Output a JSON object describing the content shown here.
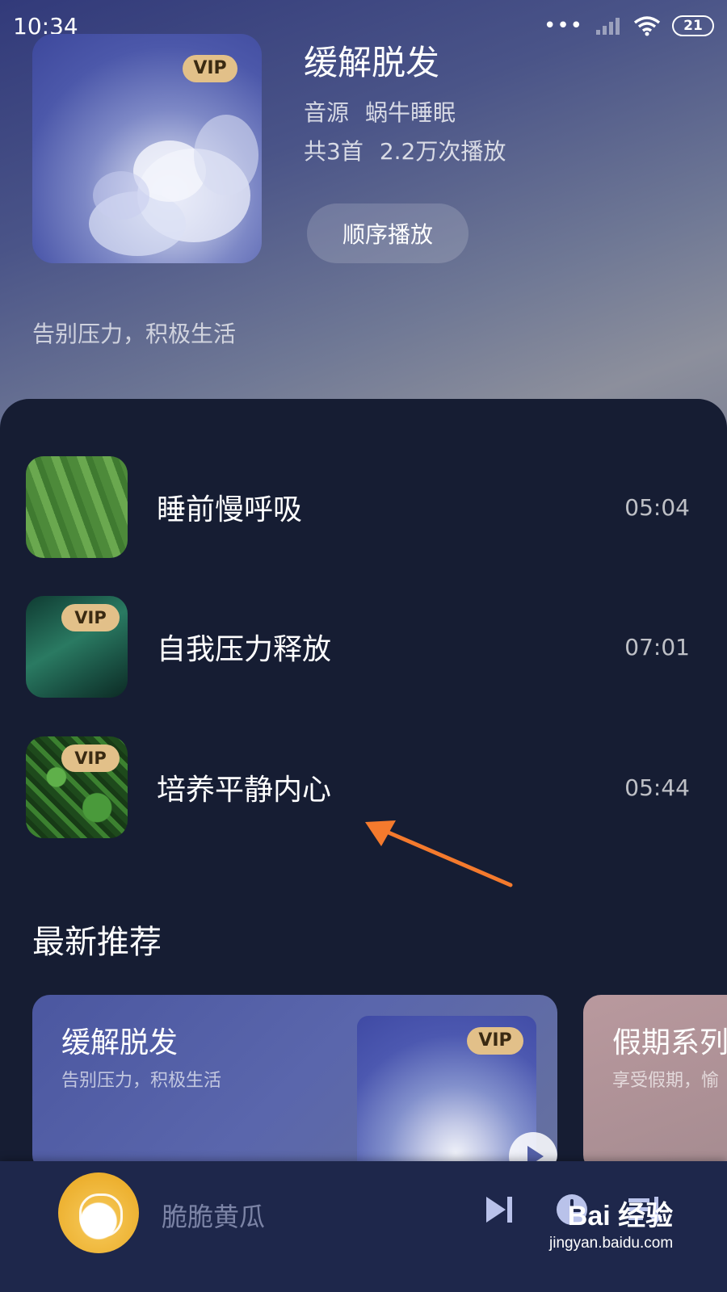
{
  "status_bar": {
    "time": "10:34",
    "battery": "21"
  },
  "album": {
    "title": "缓解脱发",
    "source_label": "音源",
    "source_name": "蜗牛睡眠",
    "track_count": "共3首",
    "play_count": "2.2万次播放",
    "play_order_button": "顺序播放",
    "description": "告别压力，积极生活",
    "vip": "VIP"
  },
  "tracks": [
    {
      "title": "睡前慢呼吸",
      "duration": "05:04",
      "vip": ""
    },
    {
      "title": "自我压力释放",
      "duration": "07:01",
      "vip": "VIP"
    },
    {
      "title": "培养平静内心",
      "duration": "05:44",
      "vip": "VIP"
    }
  ],
  "recommend": {
    "section_title": "最新推荐",
    "cards": [
      {
        "title": "缓解脱发",
        "subtitle": "告别压力，积极生活",
        "vip": "VIP"
      },
      {
        "title": "假期系列",
        "subtitle": "享受假期，愉"
      }
    ]
  },
  "player": {
    "title": "脆脆黄瓜"
  },
  "watermark": {
    "logo": "Bai 经验",
    "url": "jingyan.baidu.com"
  },
  "colors": {
    "accent_arrow": "#f47a2d",
    "vip_badge": "#e2c089",
    "background": "#161d33"
  }
}
